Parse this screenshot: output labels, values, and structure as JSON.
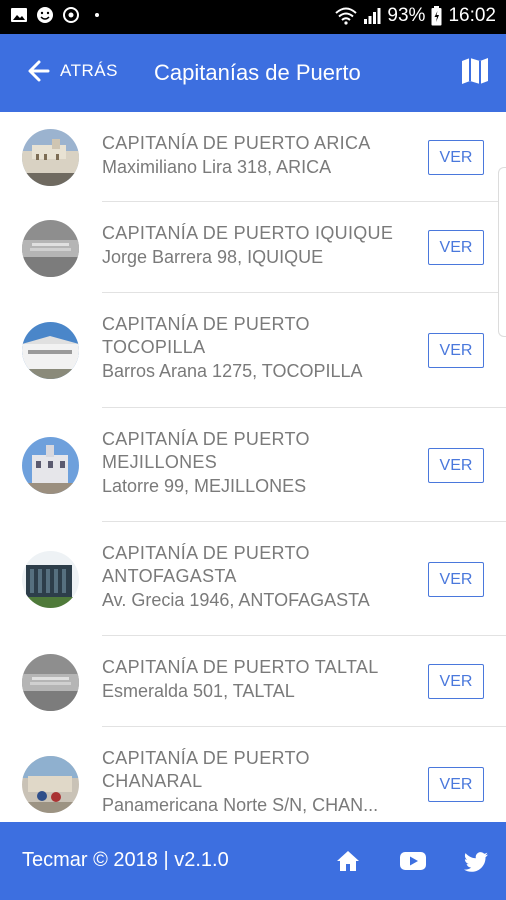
{
  "status_bar": {
    "battery": "93%",
    "time": "16:02"
  },
  "header": {
    "back_label": "ATRÁS",
    "title": "Capitanías de Puerto",
    "map_icon": "map-icon"
  },
  "items": [
    {
      "title": "CAPITANÍA DE PUERTO ARICA",
      "address": "Maximiliano Lira 318, ARICA",
      "button": "VER"
    },
    {
      "title": "CAPITANÍA DE PUERTO IQUIQUE",
      "address": "Jorge Barrera 98, IQUIQUE",
      "button": "VER"
    },
    {
      "title": "CAPITANÍA DE PUERTO TOCOPILLA",
      "address": "Barros Arana 1275, TOCOPILLA",
      "button": "VER"
    },
    {
      "title": "CAPITANÍA DE PUERTO MEJILLONES",
      "address": "Latorre 99, MEJILLONES",
      "button": "VER"
    },
    {
      "title": "CAPITANÍA DE PUERTO ANTOFAGASTA",
      "address": "Av. Grecia 1946, ANTOFAGASTA",
      "button": "VER"
    },
    {
      "title": "CAPITANÍA DE PUERTO TALTAL",
      "address": "Esmeralda 501, TALTAL",
      "button": "VER"
    },
    {
      "title": "CAPITANÍA DE PUERTO CHANARAL",
      "address": "Panamericana Norte S/N, CHAN...",
      "button": "VER"
    }
  ],
  "footer": {
    "text": "Tecmar © 2018 | v2.1.0",
    "icons": [
      "home-icon",
      "youtube-icon",
      "twitter-icon"
    ]
  },
  "colors": {
    "primary": "#3d6fe0",
    "button_border": "#4a78dc",
    "text_gray": "#7a7a7a"
  }
}
